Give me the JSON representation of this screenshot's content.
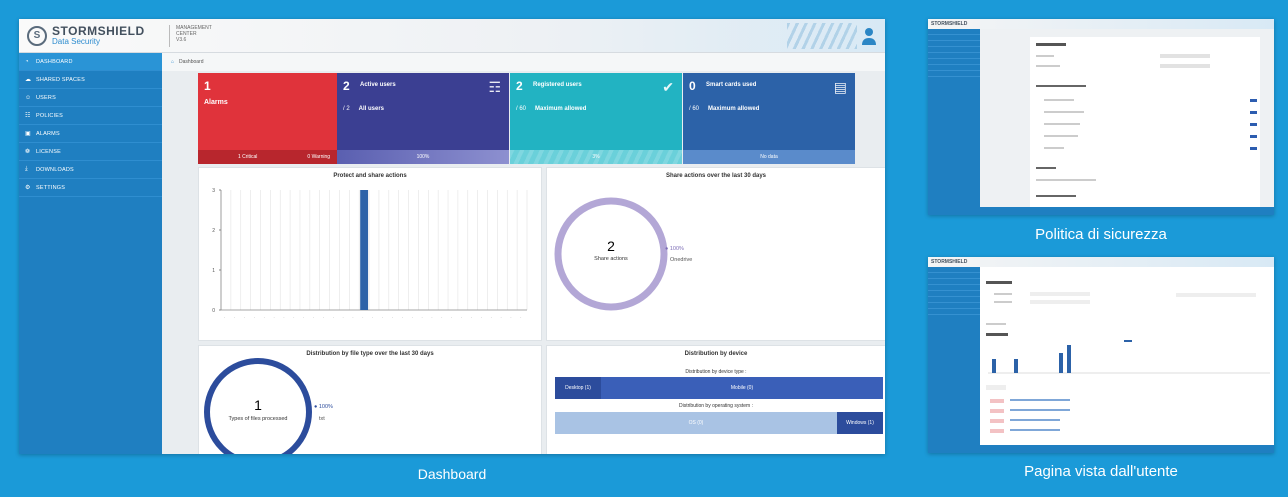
{
  "main": {
    "brand": {
      "name": "STORMSHIELD",
      "sub": "Data Security",
      "mc1": "MANAGEMENT",
      "mc2": "CENTER",
      "mc3": "V3.6"
    },
    "nav": [
      {
        "label": "DASHBOARD",
        "icon": "dashboard-icon"
      },
      {
        "label": "SHARED SPACES",
        "icon": "cloud-icon"
      },
      {
        "label": "USERS",
        "icon": "users-icon"
      },
      {
        "label": "POLICIES",
        "icon": "policy-icon"
      },
      {
        "label": "ALARMS",
        "icon": "alarm-icon"
      },
      {
        "label": "LICENSE",
        "icon": "license-icon"
      },
      {
        "label": "DOWNLOADS",
        "icon": "download-icon"
      },
      {
        "label": "SETTINGS",
        "icon": "gear-icon"
      }
    ],
    "breadcrumb": "Dashboard",
    "cards": [
      {
        "num": "1",
        "title": "",
        "sub_num": "",
        "sub_label": "",
        "big": "Alarms",
        "foot_a": "1 Critical",
        "foot_b": "0 Warning",
        "color": "#e0333b",
        "foot": "#b8262d"
      },
      {
        "num": "2",
        "title": "Active users",
        "sub_num": "/ 2",
        "sub_label": "All users",
        "big": "",
        "foot_a": "100%",
        "foot_b": "",
        "color": "#3b3f92",
        "foot": "#5a5fb0"
      },
      {
        "num": "2",
        "title": "Registered users",
        "sub_num": "/ 60",
        "sub_label": "Maximum allowed",
        "big": "",
        "foot_a": "3%",
        "foot_b": "",
        "color": "#22b3c2",
        "foot": "#6ad0da"
      },
      {
        "num": "0",
        "title": "Smart cards used",
        "sub_num": "/ 60",
        "sub_label": "Maximum allowed",
        "big": "",
        "foot_a": "No data",
        "foot_b": "",
        "color": "#2c62a8",
        "foot": "#5a8bcb"
      }
    ],
    "p1_title": "Protect and share actions",
    "p2_title": "Share actions over the last 30 days",
    "p3_title": "Distribution by file type over the last 30 days",
    "p4_title": "Distribution by device",
    "donut1": {
      "value": "2",
      "label": "Share actions",
      "pct": "100%",
      "legend": "Onedrive"
    },
    "donut2": {
      "value": "1",
      "label": "Types of files processed",
      "pct": "100%",
      "legend": "txt"
    },
    "device_type_label": "Distribution by device type :",
    "desktop": "Desktop (1)",
    "mobile": "Mobile (0)",
    "os_label": "Distribution by operating system :",
    "os_a": "OS (0)",
    "windows": "Windows (1)"
  },
  "chart_data": {
    "type": "bar",
    "title": "Protect and share actions",
    "yticks": [
      "0",
      "1",
      "2",
      "3"
    ],
    "ylim": [
      0,
      3
    ],
    "values_note": "single bar",
    "categories_count": 31,
    "bar_index": 14,
    "bar_value": 3
  },
  "labels": {
    "dashboard": "Dashboard",
    "policy": "Politica di sicurezza",
    "user": "Pagina vista dall'utente"
  }
}
